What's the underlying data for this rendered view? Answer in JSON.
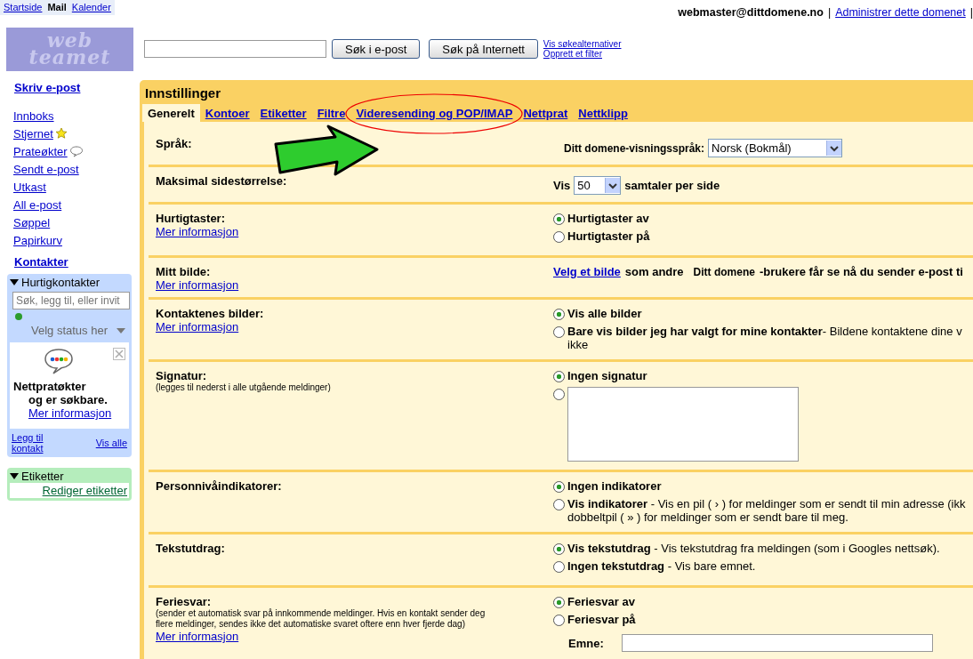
{
  "top_nav": [
    {
      "label": "Startside",
      "selected": false
    },
    {
      "label": "Mail",
      "selected": true
    },
    {
      "label": "Kalender",
      "selected": false
    }
  ],
  "account": {
    "email": "webmaster@dittdomene.no",
    "separators": [
      "|",
      "|"
    ],
    "admin_link": "Administrer dette domenet"
  },
  "logo": {
    "lines": [
      "web",
      "teamet"
    ]
  },
  "search": {
    "buttons": [
      "Søk i e-post",
      "Søk på Internett"
    ],
    "links": [
      "Vis søkealternativer",
      "Opprett et filter"
    ]
  },
  "sidebar": {
    "compose": "Skriv e-post",
    "folders": [
      {
        "label": "Innboks",
        "kind": "plain"
      },
      {
        "label": "Stjernet",
        "kind": "starred"
      },
      {
        "label": "Prateøkter",
        "kind": "chats"
      },
      {
        "label": "Sendt e-post",
        "kind": "plain"
      },
      {
        "label": "Utkast",
        "kind": "plain"
      },
      {
        "label": "All e-post",
        "kind": "plain"
      },
      {
        "label": "Søppel",
        "kind": "plain"
      },
      {
        "label": "Papirkurv",
        "kind": "plain"
      }
    ],
    "contacts": "Kontakter",
    "quick_contacts": {
      "title": "Hurtigkontakter",
      "expanded": true,
      "placeholder": "Søk, legg til, eller invit",
      "status": "Velg status her",
      "promo_title": "Nettpratøkter",
      "promo_text": "og er søkbare.",
      "promo_link": "Mer informasjon",
      "add_link": "Legg til kontakt",
      "all_link": "Vis alle"
    },
    "labels_box": {
      "title": "Etiketter",
      "expanded": true,
      "link": "Rediger etiketter"
    }
  },
  "settings": {
    "title": "Innstillinger",
    "tabs": [
      {
        "label": "Generelt",
        "selected": true,
        "highlighted": false
      },
      {
        "label": "Kontoer",
        "selected": false,
        "highlighted": false
      },
      {
        "label": "Etiketter",
        "selected": false,
        "highlighted": false
      },
      {
        "label": "Filtre",
        "selected": false,
        "highlighted": false
      },
      {
        "label": "Videresending og POP/IMAP",
        "selected": false,
        "highlighted": true
      },
      {
        "label": "Nettprat",
        "selected": false,
        "highlighted": false
      },
      {
        "label": "Nettklipp",
        "selected": false,
        "highlighted": false
      }
    ],
    "rows": [
      {
        "label": "Språk:",
        "kind": "language",
        "prefix": "Ditt domene-visningsspråk:",
        "value": "Norsk (Bokmål)"
      },
      {
        "label": "Maksimal sidestørrelse:",
        "kind": "page_size",
        "before": "Vis",
        "value": "50",
        "after": "samtaler per side"
      },
      {
        "label": "Hurtigtaster:",
        "more_info": "Mer informasjon",
        "kind": "radios",
        "options": [
          {
            "kind": "text",
            "label": "Hurtigtaster av",
            "selected": true
          },
          {
            "kind": "text",
            "label": "Hurtigtaster på",
            "selected": false
          }
        ]
      },
      {
        "label": "Mitt bilde:",
        "more_info": "Mer informasjon",
        "kind": "picture",
        "link": "Velg et bilde",
        "text": "som andre",
        "domain": "Ditt domene",
        "rest": "-brukere får se nå du sender e-post ti"
      },
      {
        "label": "Kontaktenes bilder:",
        "more_info": "Mer informasjon",
        "kind": "radios",
        "options": [
          {
            "kind": "text",
            "label": "Vis alle bilder",
            "selected": true
          },
          {
            "kind": "text",
            "label": "Bare vis bilder jeg har valgt for mine kontakter",
            "desc": "- Bildene kontaktene dine v",
            "continuation": "ikke",
            "selected": false
          }
        ]
      },
      {
        "label": "Signatur:",
        "note": "(legges til nederst i alle utgående meldinger)",
        "kind": "radios",
        "options": [
          {
            "kind": "text",
            "label": "Ingen signatur",
            "selected": true
          },
          {
            "kind": "textarea",
            "selected": false
          }
        ]
      },
      {
        "label": "Personnivåindikatorer:",
        "kind": "radios",
        "options": [
          {
            "kind": "text",
            "label": "Ingen indikatorer",
            "selected": true
          },
          {
            "kind": "text",
            "label": "Vis indikatorer",
            "desc": " - Vis en pil ( › ) for meldinger som er sendt til min adresse (ikk",
            "continuation": "dobbeltpil ( » ) for meldinger som er sendt bare til meg.",
            "selected": false
          }
        ]
      },
      {
        "label": "Tekstutdrag:",
        "kind": "radios",
        "options": [
          {
            "kind": "text",
            "label": "Vis tekstutdrag",
            "desc": " - Vis tekstutdrag fra meldingen (som i Googles nettsøk).",
            "selected": true
          },
          {
            "kind": "text",
            "label": "Ingen tekstutdrag",
            "desc": " - Vis bare emnet.",
            "selected": false
          }
        ]
      },
      {
        "label": "Feriesvar:",
        "note": "(sender et automatisk svar på innkommende meldinger. Hvis en kontakt sender deg flere meldinger, sendes ikke det automatiske svaret oftere enn hver fjerde dag)",
        "more_info": "Mer informasjon",
        "kind": "radios",
        "options": [
          {
            "kind": "text",
            "label": "Feriesvar av",
            "selected": true
          },
          {
            "kind": "text",
            "label": "Feriesvar på",
            "selected": false
          }
        ],
        "fields": [
          {
            "label": "Emne:"
          }
        ]
      }
    ]
  }
}
